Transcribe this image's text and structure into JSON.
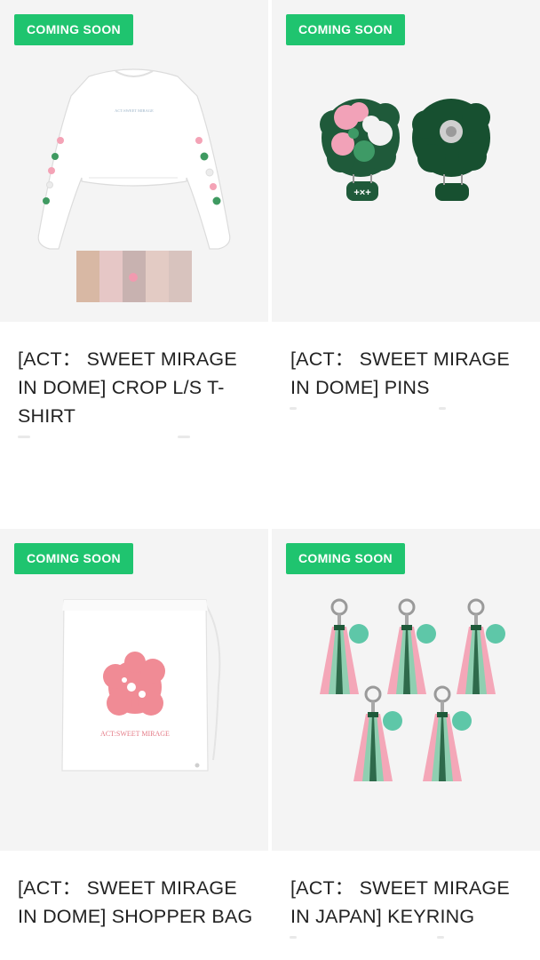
{
  "products": [
    {
      "badge": "COMING SOON",
      "title": "[ACT：  SWEET MIRAGE IN DOME] CROP L/S T-SHIRT",
      "print_text": "ACT:SWEET MIRAGE",
      "image_icon": "crop-longsleeve-tshirt-with-photocards"
    },
    {
      "badge": "COMING SOON",
      "title": "[ACT：  SWEET MIRAGE IN DOME] PINS",
      "pin_text": "+×+",
      "image_icon": "flower-pins"
    },
    {
      "badge": "COMING SOON",
      "title": "[ACT：  SWEET MIRAGE IN DOME] SHOPPER BAG",
      "print_text": "ACT:SWEET MIRAGE",
      "image_icon": "drawstring-shopper-bag"
    },
    {
      "badge": "COMING SOON",
      "title": "[ACT：  SWEET MIRAGE IN JAPAN] KEYRING",
      "image_icon": "tassel-keyrings"
    }
  ],
  "colors": {
    "badge_bg": "#1fc46f",
    "card_bg": "#f4f4f4",
    "pink": "#f5a0b0",
    "green": "#1f5a3a",
    "mint": "#5ec7a8"
  }
}
